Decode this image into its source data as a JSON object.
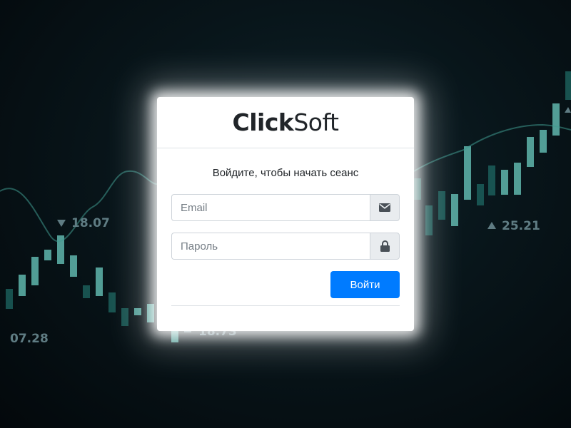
{
  "brand": {
    "logo_bold": "Click",
    "logo_light": "Soft"
  },
  "login": {
    "message": "Войдите, чтобы начать сеанс",
    "email_placeholder": "Email",
    "password_placeholder": "Пароль",
    "submit_label": "Войти"
  },
  "icons": {
    "email": "envelope-icon",
    "password": "lock-icon"
  },
  "background": {
    "labels": [
      "18.07",
      "25.21",
      "07.28",
      "18.73"
    ],
    "colors": {
      "candle_light": "#5fb6ad",
      "candle_dark": "#1f6d68",
      "curve": "#3f9a8f",
      "label": "#5f7c83"
    }
  },
  "colors": {
    "primary": "#007bff",
    "card": "#ffffff",
    "addon": "#e9ecef",
    "border": "#ced4da"
  }
}
